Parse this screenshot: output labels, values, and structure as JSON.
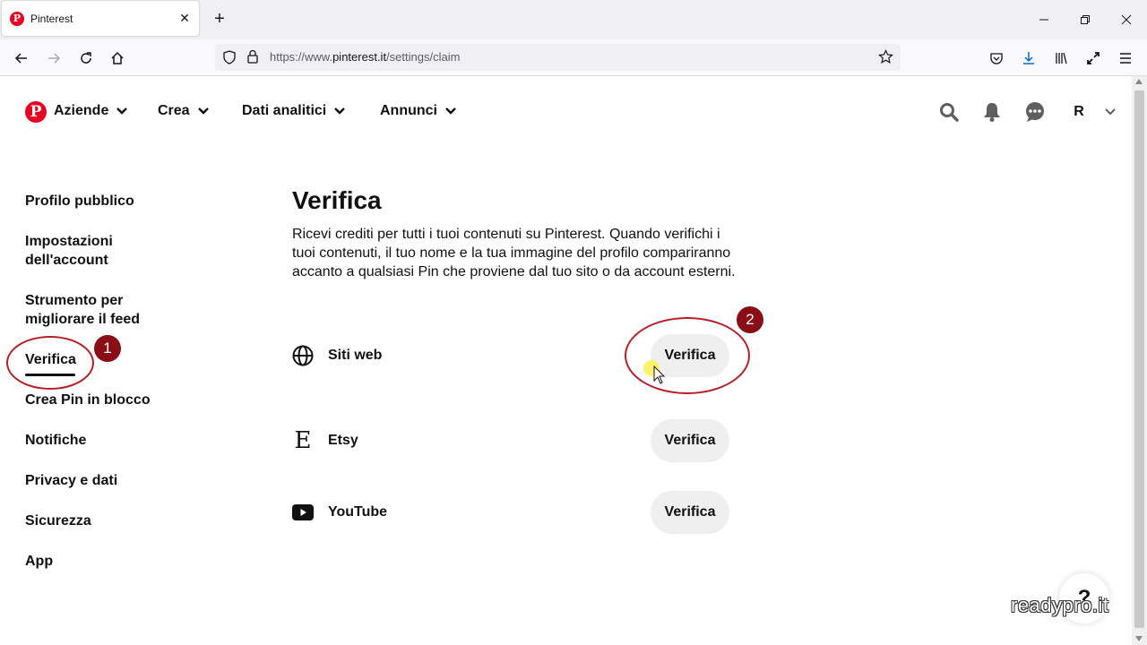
{
  "browser": {
    "tab_title": "Pinterest",
    "url_prefix": "https://www.",
    "url_domain": "pinterest.it",
    "url_path": "/settings/claim"
  },
  "header": {
    "nav": [
      {
        "label": "Aziende"
      },
      {
        "label": "Crea"
      },
      {
        "label": "Dati analitici"
      },
      {
        "label": "Annunci"
      }
    ],
    "avatar_initial": "R"
  },
  "sidebar": {
    "items": [
      {
        "label": "Profilo pubblico"
      },
      {
        "label": "Impostazioni dell'account"
      },
      {
        "label": "Strumento per migliorare il feed"
      },
      {
        "label": "Verifica",
        "active": true
      },
      {
        "label": "Crea Pin in blocco"
      },
      {
        "label": "Notifiche"
      },
      {
        "label": "Privacy e dati"
      },
      {
        "label": "Sicurezza"
      },
      {
        "label": "App"
      }
    ]
  },
  "main": {
    "title": "Verifica",
    "description": "Ricevi crediti per tutti i tuoi contenuti su Pinterest. Quando verifichi i tuoi contenuti, il tuo nome e la tua immagine del profilo compariranno accanto a qualsiasi Pin che proviene dal tuo sito o da account esterni.",
    "rows": [
      {
        "label": "Siti web",
        "icon": "globe-icon",
        "button": "Verifica"
      },
      {
        "label": "Etsy",
        "icon": "etsy-icon",
        "button": "Verifica"
      },
      {
        "label": "YouTube",
        "icon": "youtube-icon",
        "button": "Verifica"
      }
    ]
  },
  "annotations": {
    "badge_1": "1",
    "badge_2": "2",
    "color": "#b51f27"
  },
  "help_label": "?",
  "watermark": "readypro.it",
  "colors": {
    "brand": "#e60023",
    "button_bg": "#efefef"
  }
}
